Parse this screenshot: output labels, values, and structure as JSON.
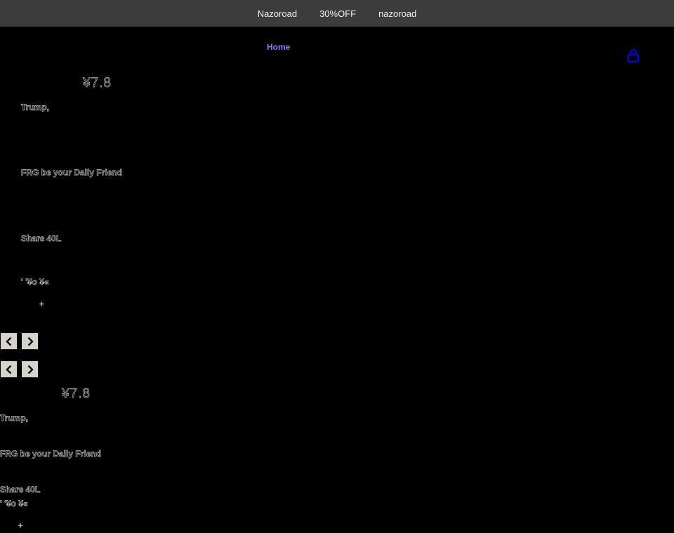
{
  "announcement": {
    "items": [
      "Nazoroad",
      "30%OFF",
      "nazoroad"
    ]
  },
  "nav": {
    "home_label": "Home"
  },
  "icons": {
    "cart": "cart-icon",
    "prev": "chevron-left-icon",
    "next": "chevron-right-icon"
  },
  "colors": {
    "bar_bg": "#3c3c3c",
    "nav_link": "#7f7fff",
    "cart": "#0000ff"
  },
  "slides": [
    {
      "price": "¥7.8",
      "title": "Trump,",
      "tagline": "FRG  be your Daily Friend",
      "size": "Share  40L",
      "extra": "' '¥o ¥«",
      "plus": "+"
    },
    {
      "price": "¥7.8",
      "title": "Trump,",
      "tagline": "FRG  be your Daily Friend",
      "size": "Share  40L",
      "extra": "' '¥o ¥«",
      "plus": "+"
    }
  ]
}
